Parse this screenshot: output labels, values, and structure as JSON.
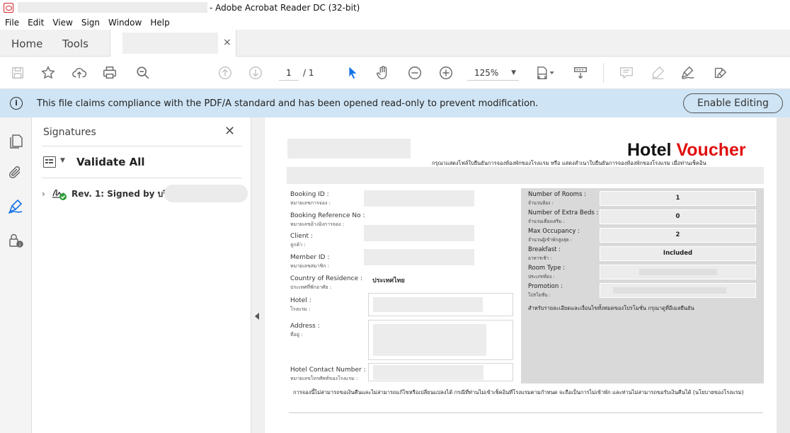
{
  "window": {
    "title": "- Adobe Acrobat Reader DC (32-bit)"
  },
  "menu": {
    "items": [
      "File",
      "Edit",
      "View",
      "Sign",
      "Window",
      "Help"
    ]
  },
  "tabs": {
    "home": "Home",
    "tools": "Tools",
    "close": "×"
  },
  "toolbar": {
    "page_current": "1",
    "page_total": "/ 1",
    "zoom": "125%",
    "icons": [
      "save-icon",
      "star-icon",
      "upload-icon",
      "print-icon",
      "zoom-search-icon",
      "page-up-icon",
      "page-down-icon",
      "select-arrow-icon",
      "hand-icon",
      "zoom-out-icon",
      "zoom-in-icon",
      "fit-page-icon",
      "scroll-mode-icon",
      "comment-icon",
      "highlight-icon",
      "sign-icon",
      "fill-sign-icon"
    ]
  },
  "infobar": {
    "message": "This file claims compliance with the PDF/A standard and has been opened read-only to prevent modification.",
    "button": "Enable Editing"
  },
  "signatures": {
    "title": "Signatures",
    "validate_all": "Validate All",
    "revision": "Rev. 1: Signed by บริษัท"
  },
  "voucher": {
    "title_black": "Hotel",
    "title_red": "Voucher",
    "subtitle": "กรุณาแสดงไฟล์ใบยืนยันการจองห้องพักของโรงแรม หรือ แสดงสำเนาใบยืนยันการจองห้องพักของโรงแรม เมื่อท่านเช็คอิน",
    "left_fields": [
      {
        "label": "Booking ID :",
        "sub": "หมายเลขการจอง :"
      },
      {
        "label": "Booking Reference No :",
        "sub": "หมายเลขอ้างอิงการจอง :"
      },
      {
        "label": "Client :",
        "sub": "ลูกค้า :"
      },
      {
        "label": "Member ID :",
        "sub": "หมายเลขสมาชิก :"
      },
      {
        "label": "Country of Residence :",
        "sub": "ประเทศที่พักอาศัย :"
      },
      {
        "label": "Hotel :",
        "sub": "โรงแรม :"
      },
      {
        "label": "Address :",
        "sub": "ที่อยู่ :"
      },
      {
        "label": "Hotel Contact Number :",
        "sub": "หมายเลขโทรศัพท์ของโรงแรม :"
      }
    ],
    "country_value": "ประเทศไทย",
    "right_fields": [
      {
        "label": "Number of Rooms :",
        "sub": "จำนวนห้อง :",
        "value": "1"
      },
      {
        "label": "Number of Extra Beds :",
        "sub": "จำนวนเตียงเสริม :",
        "value": "0"
      },
      {
        "label": "Max Occupancy :",
        "sub": "จำนวนผู้เข้าพักสูงสุด :",
        "value": "2"
      },
      {
        "label": "Breakfast :",
        "sub": "อาหารเช้า :",
        "value": "Included"
      },
      {
        "label": "Room Type :",
        "sub": "ประเภทห้อง :",
        "value": ""
      },
      {
        "label": "Promotion :",
        "sub": "โปรโมชั่น :",
        "value": ""
      }
    ],
    "promo_note": "สำหรับรายละเอียดและเงื่อนไขทั้งหมดของโปรโมชั่น กรุณาดูที่อีเมลยืนยัน",
    "footer_note": "การจองนี้ไม่สามารถขอเงินคืนและไม่สามารถแก้ไขหรือเปลี่ยนแปลงได้ กรณีที่ท่านไม่เข้าเช็คอินที่โรงแรมตามกำหนด จะถือเป็นการไม่เข้าพัก และท่านไม่สามารถขอรับเงินคืนได้ (นโยบายของโรงแรม)"
  }
}
